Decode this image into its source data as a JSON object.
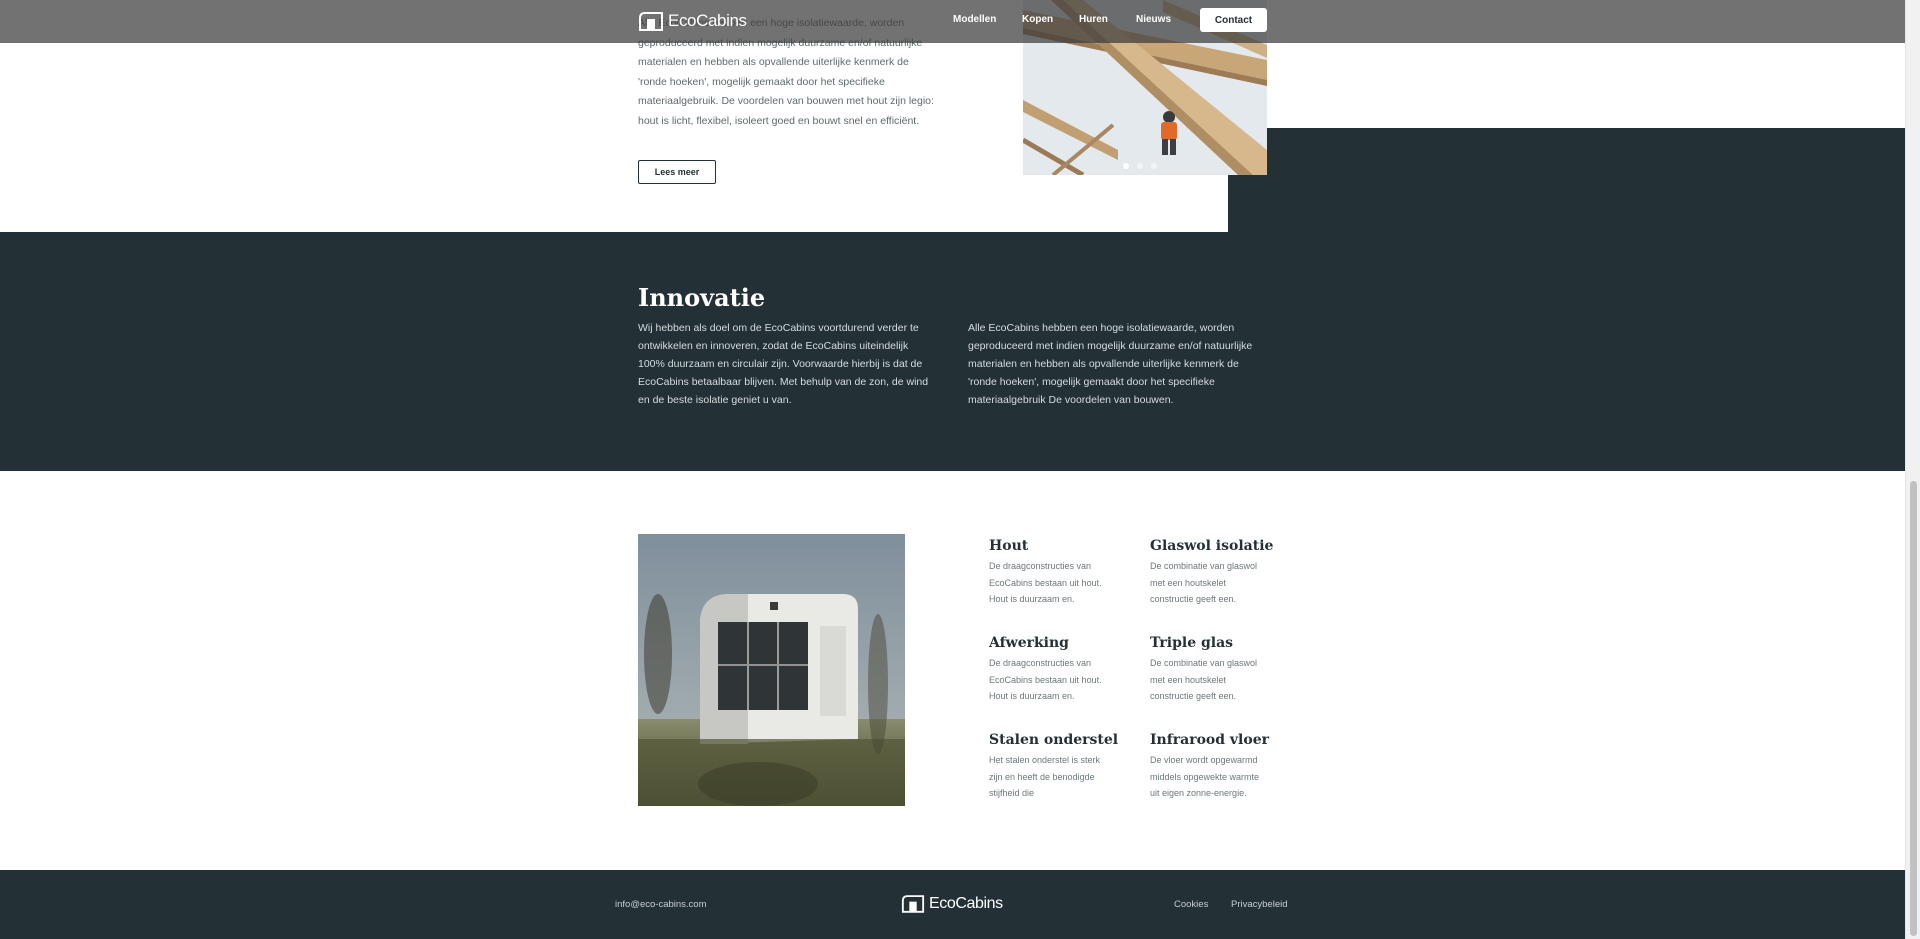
{
  "header": {
    "brand": "EcoCabins",
    "nav": [
      "Modellen",
      "Kopen",
      "Huren",
      "Nieuws"
    ],
    "contact": "Contact"
  },
  "intro": {
    "text": "Alle EcoCabins hebben een hoge isolatiewaarde, worden geproduceerd met indien mogelijk duurzame en/of natuurlijke materialen en hebben als opvallende uiterlijke kenmerk de 'ronde hoeken', mogelijk gemaakt door het specifieke materiaalgebruik. De voordelen van bouwen met hout zijn legio: hout is licht, flexibel, isoleert goed en bouwt snel en efficiënt.",
    "button": "Lees meer"
  },
  "slider": {
    "slides": 3,
    "active": 1
  },
  "innovatie": {
    "title": "Innovatie",
    "left": "Wij hebben als doel om de EcoCabins voortdurend verder te ontwikkelen en innoveren, zodat de EcoCabins uiteindelijk 100% duurzaam en circulair zijn. Voorwaarde hierbij is dat de EcoCabins betaalbaar blijven. Met behulp van de zon, de wind en de beste isolatie geniet u van.",
    "right": "Alle EcoCabins hebben een hoge isolatiewaarde, worden geproduceerd met indien mogelijk duurzame en/of natuurlijke materialen en hebben als opvallende uiterlijke kenmerk de 'ronde hoeken', mogelijk gemaakt door het specifieke materiaalgebruik De voordelen van bouwen."
  },
  "features": [
    {
      "title": "Hout",
      "text": "De draagconstructies van EcoCabins bestaan uit hout. Hout is duurzaam en."
    },
    {
      "title": "Glaswol isolatie",
      "text": "De combinatie van glaswol met een houtskelet constructie geeft een."
    },
    {
      "title": "Afwerking",
      "text": "De draagconstructies van EcoCabins bestaan uit hout. Hout is duurzaam en."
    },
    {
      "title": "Triple glas",
      "text": "De combinatie van glaswol met een houtskelet constructie geeft een."
    },
    {
      "title": "Stalen onderstel",
      "text": "Het stalen onderstel is sterk zijn en heeft de benodigde stijfheid die"
    },
    {
      "title": "Infrarood vloer",
      "text": "De vloer wordt opgewarmd middels opgewekte warmte uit eigen zonne-energie."
    }
  ],
  "footer": {
    "email": "info@eco-cabins.com",
    "brand": "EcoCabins",
    "links": [
      "Cookies",
      "Privacybeleid"
    ]
  },
  "colors": {
    "dark": "#233035",
    "text_muted": "#6c777b",
    "white": "#ffffff"
  }
}
